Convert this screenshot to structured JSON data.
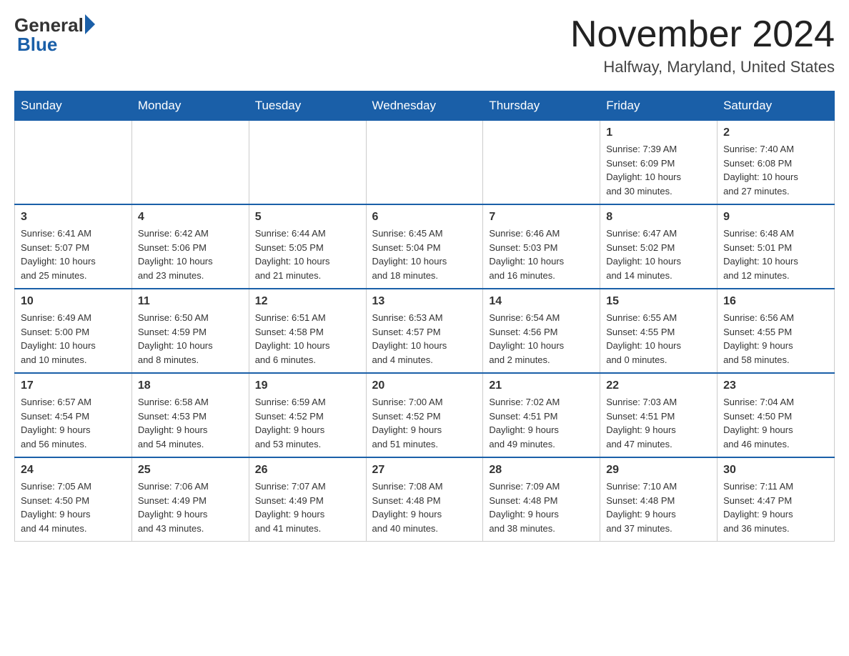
{
  "header": {
    "logo_general": "General",
    "logo_blue": "Blue",
    "main_title": "November 2024",
    "subtitle": "Halfway, Maryland, United States"
  },
  "weekdays": [
    "Sunday",
    "Monday",
    "Tuesday",
    "Wednesday",
    "Thursday",
    "Friday",
    "Saturday"
  ],
  "weeks": [
    [
      {
        "day": "",
        "info": ""
      },
      {
        "day": "",
        "info": ""
      },
      {
        "day": "",
        "info": ""
      },
      {
        "day": "",
        "info": ""
      },
      {
        "day": "",
        "info": ""
      },
      {
        "day": "1",
        "info": "Sunrise: 7:39 AM\nSunset: 6:09 PM\nDaylight: 10 hours\nand 30 minutes."
      },
      {
        "day": "2",
        "info": "Sunrise: 7:40 AM\nSunset: 6:08 PM\nDaylight: 10 hours\nand 27 minutes."
      }
    ],
    [
      {
        "day": "3",
        "info": "Sunrise: 6:41 AM\nSunset: 5:07 PM\nDaylight: 10 hours\nand 25 minutes."
      },
      {
        "day": "4",
        "info": "Sunrise: 6:42 AM\nSunset: 5:06 PM\nDaylight: 10 hours\nand 23 minutes."
      },
      {
        "day": "5",
        "info": "Sunrise: 6:44 AM\nSunset: 5:05 PM\nDaylight: 10 hours\nand 21 minutes."
      },
      {
        "day": "6",
        "info": "Sunrise: 6:45 AM\nSunset: 5:04 PM\nDaylight: 10 hours\nand 18 minutes."
      },
      {
        "day": "7",
        "info": "Sunrise: 6:46 AM\nSunset: 5:03 PM\nDaylight: 10 hours\nand 16 minutes."
      },
      {
        "day": "8",
        "info": "Sunrise: 6:47 AM\nSunset: 5:02 PM\nDaylight: 10 hours\nand 14 minutes."
      },
      {
        "day": "9",
        "info": "Sunrise: 6:48 AM\nSunset: 5:01 PM\nDaylight: 10 hours\nand 12 minutes."
      }
    ],
    [
      {
        "day": "10",
        "info": "Sunrise: 6:49 AM\nSunset: 5:00 PM\nDaylight: 10 hours\nand 10 minutes."
      },
      {
        "day": "11",
        "info": "Sunrise: 6:50 AM\nSunset: 4:59 PM\nDaylight: 10 hours\nand 8 minutes."
      },
      {
        "day": "12",
        "info": "Sunrise: 6:51 AM\nSunset: 4:58 PM\nDaylight: 10 hours\nand 6 minutes."
      },
      {
        "day": "13",
        "info": "Sunrise: 6:53 AM\nSunset: 4:57 PM\nDaylight: 10 hours\nand 4 minutes."
      },
      {
        "day": "14",
        "info": "Sunrise: 6:54 AM\nSunset: 4:56 PM\nDaylight: 10 hours\nand 2 minutes."
      },
      {
        "day": "15",
        "info": "Sunrise: 6:55 AM\nSunset: 4:55 PM\nDaylight: 10 hours\nand 0 minutes."
      },
      {
        "day": "16",
        "info": "Sunrise: 6:56 AM\nSunset: 4:55 PM\nDaylight: 9 hours\nand 58 minutes."
      }
    ],
    [
      {
        "day": "17",
        "info": "Sunrise: 6:57 AM\nSunset: 4:54 PM\nDaylight: 9 hours\nand 56 minutes."
      },
      {
        "day": "18",
        "info": "Sunrise: 6:58 AM\nSunset: 4:53 PM\nDaylight: 9 hours\nand 54 minutes."
      },
      {
        "day": "19",
        "info": "Sunrise: 6:59 AM\nSunset: 4:52 PM\nDaylight: 9 hours\nand 53 minutes."
      },
      {
        "day": "20",
        "info": "Sunrise: 7:00 AM\nSunset: 4:52 PM\nDaylight: 9 hours\nand 51 minutes."
      },
      {
        "day": "21",
        "info": "Sunrise: 7:02 AM\nSunset: 4:51 PM\nDaylight: 9 hours\nand 49 minutes."
      },
      {
        "day": "22",
        "info": "Sunrise: 7:03 AM\nSunset: 4:51 PM\nDaylight: 9 hours\nand 47 minutes."
      },
      {
        "day": "23",
        "info": "Sunrise: 7:04 AM\nSunset: 4:50 PM\nDaylight: 9 hours\nand 46 minutes."
      }
    ],
    [
      {
        "day": "24",
        "info": "Sunrise: 7:05 AM\nSunset: 4:50 PM\nDaylight: 9 hours\nand 44 minutes."
      },
      {
        "day": "25",
        "info": "Sunrise: 7:06 AM\nSunset: 4:49 PM\nDaylight: 9 hours\nand 43 minutes."
      },
      {
        "day": "26",
        "info": "Sunrise: 7:07 AM\nSunset: 4:49 PM\nDaylight: 9 hours\nand 41 minutes."
      },
      {
        "day": "27",
        "info": "Sunrise: 7:08 AM\nSunset: 4:48 PM\nDaylight: 9 hours\nand 40 minutes."
      },
      {
        "day": "28",
        "info": "Sunrise: 7:09 AM\nSunset: 4:48 PM\nDaylight: 9 hours\nand 38 minutes."
      },
      {
        "day": "29",
        "info": "Sunrise: 7:10 AM\nSunset: 4:48 PM\nDaylight: 9 hours\nand 37 minutes."
      },
      {
        "day": "30",
        "info": "Sunrise: 7:11 AM\nSunset: 4:47 PM\nDaylight: 9 hours\nand 36 minutes."
      }
    ]
  ]
}
